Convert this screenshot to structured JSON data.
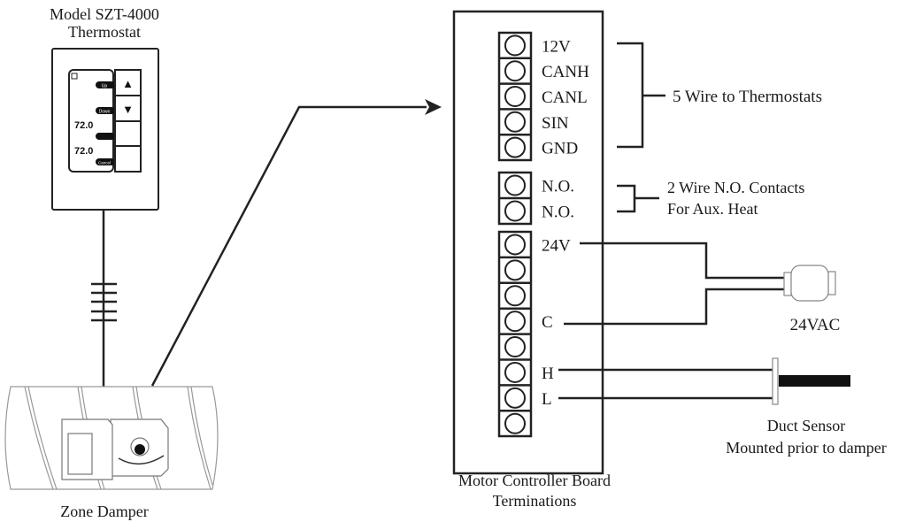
{
  "thermostat": {
    "title_line1": "Model SZT-4000",
    "title_line2": "Thermostat",
    "buttons": [
      "Up",
      "Down",
      "",
      "Cancel"
    ],
    "readings": [
      "72.0",
      "72.0"
    ],
    "arrow_up": "▲",
    "arrow_down": "▼"
  },
  "damper": {
    "label": "Zone Damper"
  },
  "board": {
    "label_line1": "Motor Controller Board",
    "label_line2": "Terminations",
    "group1_terminals": [
      "12V",
      "CANH",
      "CANL",
      "SIN",
      "GND"
    ],
    "group2_terminals": [
      "N.O.",
      "N.O."
    ],
    "group3_terminals": [
      "24V",
      "",
      "",
      "C",
      "",
      "H",
      "L",
      ""
    ]
  },
  "annotations": {
    "five_wire": "5 Wire to Thermostats",
    "two_wire_line1": "2 Wire N.O. Contacts",
    "two_wire_line2": "For Aux. Heat",
    "transformer": "24VAC",
    "duct_sensor_line1": "Duct Sensor",
    "duct_sensor_line2": "Mounted prior to damper"
  }
}
